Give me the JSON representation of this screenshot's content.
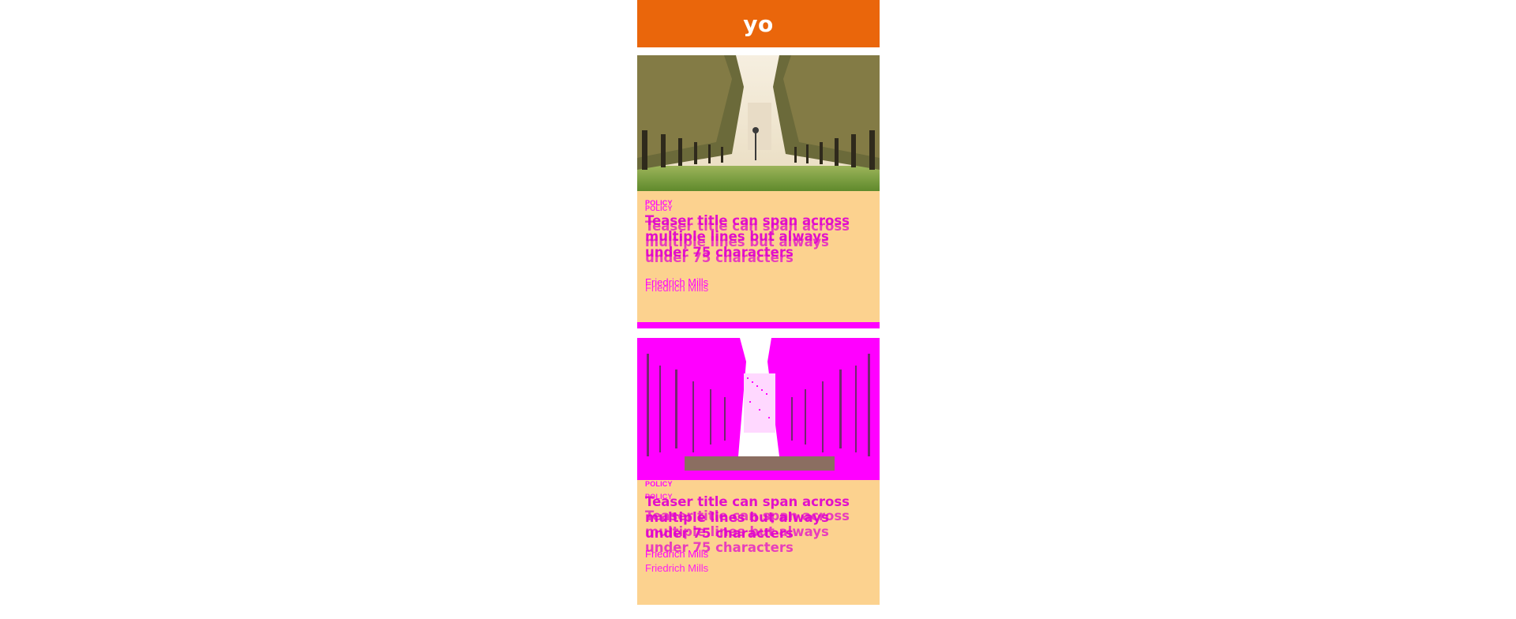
{
  "header": {
    "title": "yo",
    "color": "#ea660b"
  },
  "cards": [
    {
      "category": "POLICY",
      "title": "Teaser title can span across multiple lines but always under 75 characters",
      "author": "Friedrich Mills",
      "image": "palm-avenue-photo"
    },
    {
      "category": "POLICY",
      "title": "Teaser title can span across multiple lines but always under 75 characters",
      "author": "Friedrich Mills",
      "image": "palm-avenue-photo-magenta"
    }
  ],
  "colors": {
    "card_background": "#fcd28f",
    "accent": "#ff00ff"
  }
}
